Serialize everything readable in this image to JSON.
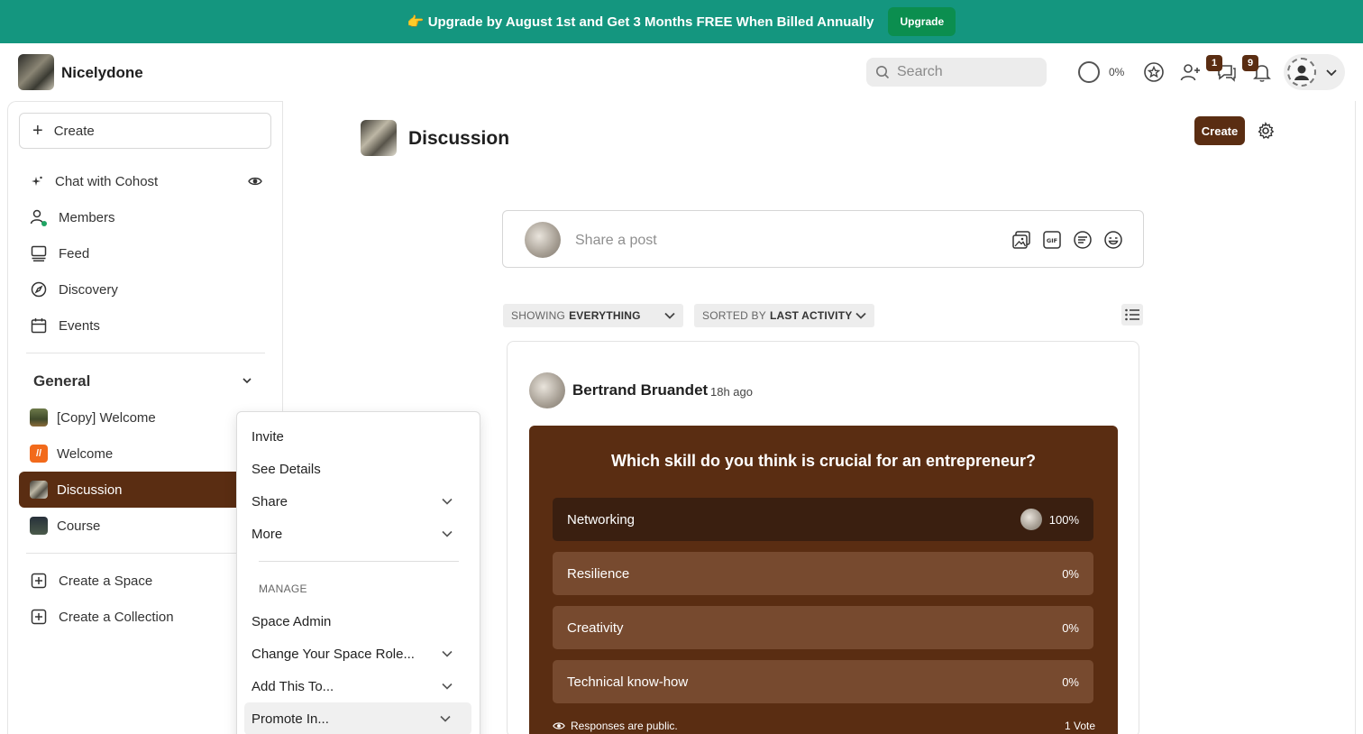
{
  "banner": {
    "text": "👉 Upgrade by August 1st and Get 3 Months FREE When Billed Annually",
    "button": "Upgrade"
  },
  "header": {
    "brand": "Nicelydone",
    "search_placeholder": "Search",
    "progress": "0%",
    "members_badge": "1",
    "messages_badge": "9"
  },
  "sidebar": {
    "create_label": "Create",
    "nav": [
      {
        "label": "Chat with Cohost",
        "icon": "sparkle-icon"
      },
      {
        "label": "Members",
        "icon": "members-icon"
      },
      {
        "label": "Feed",
        "icon": "feed-icon"
      },
      {
        "label": "Discovery",
        "icon": "compass-icon"
      },
      {
        "label": "Events",
        "icon": "calendar-icon"
      }
    ],
    "section_title": "General",
    "spaces": [
      {
        "label": "[Copy] Welcome"
      },
      {
        "label": "Welcome"
      },
      {
        "label": "Discussion"
      },
      {
        "label": "Course"
      }
    ],
    "create_space": "Create a Space",
    "create_collection": "Create a Collection"
  },
  "dropdown": {
    "items": [
      "Invite",
      "See Details",
      "Share",
      "More"
    ],
    "section": "MANAGE",
    "manage_items": [
      "Space Admin",
      "Change Your Space Role...",
      "Add This To...",
      "Promote In..."
    ]
  },
  "main": {
    "title": "Discussion",
    "create_button": "Create",
    "composer_placeholder": "Share a post",
    "filter_show_prefix": "SHOWING",
    "filter_show_value": "EVERYTHING",
    "filter_sort_prefix": "SORTED BY",
    "filter_sort_value": "LAST ACTIVITY"
  },
  "post": {
    "author": "Bertrand Bruandet",
    "time": "18h ago",
    "poll": {
      "question": "Which skill do you think is crucial for an entrepreneur?",
      "options": [
        {
          "label": "Networking",
          "percent": "100%"
        },
        {
          "label": "Resilience",
          "percent": "0%"
        },
        {
          "label": "Creativity",
          "percent": "0%"
        },
        {
          "label": "Technical know-how",
          "percent": "0%"
        }
      ],
      "footer_note": "Responses are public.",
      "votes": "1 Vote"
    }
  },
  "colors": {
    "banner": "#14967f",
    "upgrade_button": "#0b8e4f",
    "brand_brown": "#5a2d12",
    "poll_option": "#774a2f",
    "poll_option_top": "#3a1f10"
  }
}
